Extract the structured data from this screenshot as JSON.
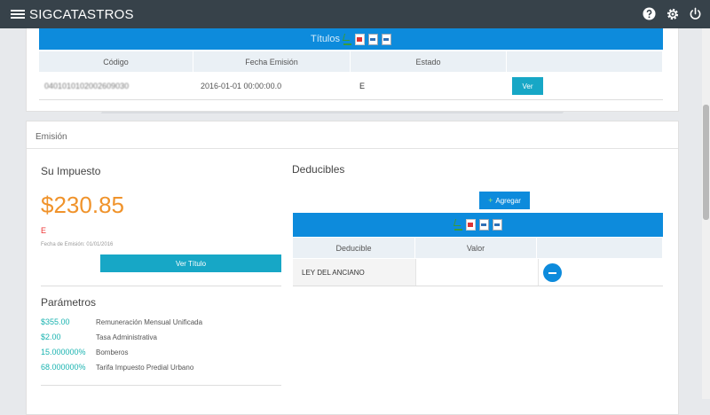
{
  "app": {
    "title": "SIGCATASTROS"
  },
  "titulos": {
    "title": "Títulos",
    "columns": [
      "Código",
      "Fecha Emisión",
      "Estado",
      ""
    ],
    "rows": [
      {
        "codigo": "0401010102002609030",
        "fecha": "2016-01-01 00:00:00.0",
        "estado": "E",
        "action": "Ver"
      }
    ]
  },
  "emision": {
    "title": "Emisión",
    "su_impuesto": {
      "title": "Su Impuesto",
      "amount": "$230.85",
      "marker": "E",
      "fecha": "Fecha de Emisión: 01/01/2016",
      "button": "Ver Título"
    },
    "parametros": {
      "title": "Parámetros",
      "items": [
        {
          "value": "$355.00",
          "label": "Remuneración Mensual Unificada"
        },
        {
          "value": "$2.00",
          "label": "Tasa Administrativa"
        },
        {
          "value": "15.000000%",
          "label": "Bomberos"
        },
        {
          "value": "68.000000%",
          "label": "Tarifa Impuesto Predial Urbano"
        }
      ]
    },
    "deducibles": {
      "title": "Deducibles",
      "add_button": "Agregar",
      "columns": [
        "Deducible",
        "Valor",
        ""
      ],
      "rows": [
        {
          "deducible": "LEY DEL ANCIANO",
          "valor": ""
        }
      ]
    }
  },
  "colors": {
    "topbar": "#37424a",
    "accent_blue": "#0d8bdc",
    "teal": "#17a7c6",
    "amount_orange": "#f0932b",
    "param_teal": "#19b3b0"
  }
}
